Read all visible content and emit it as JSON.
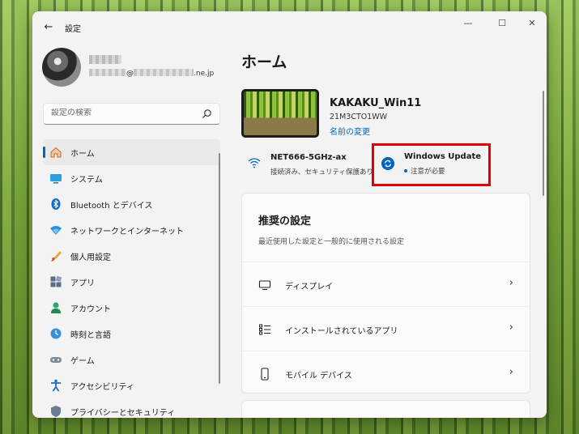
{
  "window": {
    "title": "設定",
    "back_glyph": "←",
    "minimize_glyph": "—",
    "maximize_glyph": "☐",
    "close_glyph": "✕"
  },
  "user": {
    "email_suffix": ".ne.jp",
    "email_at": "@"
  },
  "search": {
    "placeholder": "設定の検索"
  },
  "sidebar": {
    "items": [
      {
        "label": "ホーム",
        "icon": "home-icon"
      },
      {
        "label": "システム",
        "icon": "system-icon"
      },
      {
        "label": "Bluetooth とデバイス",
        "icon": "bluetooth-icon"
      },
      {
        "label": "ネットワークとインターネット",
        "icon": "network-icon"
      },
      {
        "label": "個人用設定",
        "icon": "personalization-icon"
      },
      {
        "label": "アプリ",
        "icon": "apps-icon"
      },
      {
        "label": "アカウント",
        "icon": "account-icon"
      },
      {
        "label": "時刻と言語",
        "icon": "time-language-icon"
      },
      {
        "label": "ゲーム",
        "icon": "gaming-icon"
      },
      {
        "label": "アクセシビリティ",
        "icon": "accessibility-icon"
      },
      {
        "label": "プライバシーとセキュリティ",
        "icon": "privacy-icon"
      }
    ],
    "active_index": 0
  },
  "main": {
    "page_title": "ホーム",
    "device": {
      "name": "KAKAKU_Win11",
      "model": "21M3CTO1WW",
      "rename_link": "名前の変更"
    },
    "network": {
      "name": "NET666-5GHz-ax",
      "status": "接続済み、セキュリティ保護あり"
    },
    "windows_update": {
      "title": "Windows Update",
      "status": "注意が必要"
    },
    "recommended": {
      "title": "推奨の設定",
      "subtitle": "最近使用した設定と一般的に使用される設定",
      "rows": [
        {
          "label": "ディスプレイ",
          "icon": "display-icon"
        },
        {
          "label": "インストールされているアプリ",
          "icon": "installed-apps-icon"
        },
        {
          "label": "モバイル デバイス",
          "icon": "mobile-device-icon"
        }
      ],
      "chevron": "›"
    }
  },
  "colors": {
    "accent": "#0067c0",
    "highlight": "#e00000"
  }
}
